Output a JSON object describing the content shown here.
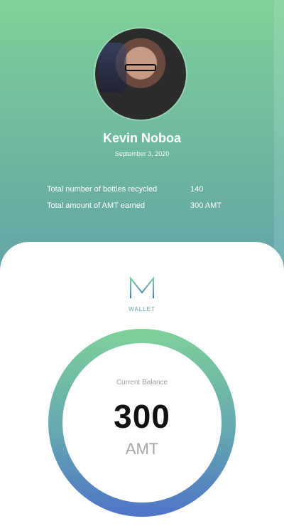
{
  "profile": {
    "name": "Kevin Noboa",
    "date": "September 3, 2020"
  },
  "stats": [
    {
      "label": "Total number of bottles recycled",
      "value": "140"
    },
    {
      "label": "Total amount of AMT earned",
      "value": "300 AMT"
    }
  ],
  "wallet": {
    "logo_text": "WALLET",
    "balance_label": "Current Balance",
    "balance_amount": "300",
    "balance_unit": "AMT"
  },
  "colors": {
    "gradient_top": "#7fd19a",
    "gradient_bottom": "#5b82c8",
    "ring_top": "#7fd19a",
    "ring_bottom": "#4f73c8"
  },
  "icons": {
    "avatar": "user-photo",
    "logo": "wallet-m-logo"
  }
}
